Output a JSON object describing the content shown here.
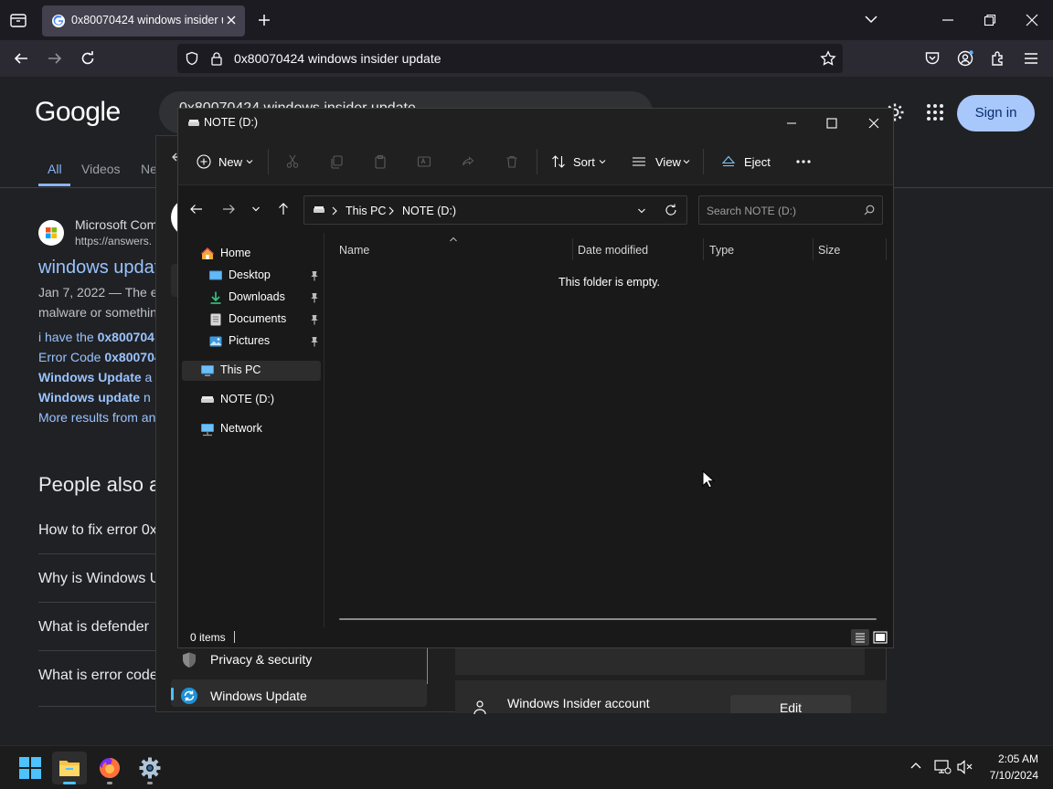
{
  "browser": {
    "tab_title": "0x80070424 windows insider update",
    "url": "0x80070424 windows insider update"
  },
  "google": {
    "logo": "Google",
    "search_partial": "0x80070424 windows insider update",
    "sign_in": "Sign in",
    "tabs": [
      "All",
      "Videos",
      "Ne"
    ],
    "result_source": "Microsoft Com",
    "result_url": "https://answers.",
    "result_title": "windows updat",
    "result_snippet_1": "Jan 7, 2022 — The e",
    "result_snippet_2": "malware or somethin",
    "sub_1_prefix": "i have the ",
    "sub_1_bold": "0x800704",
    "sub_2_prefix": "Error Code ",
    "sub_2_bold": "0x800704",
    "sub_3_bold": "Windows Update",
    "sub_3_suffix": " a",
    "sub_4_bold": "Windows update",
    "sub_4_suffix": " n",
    "more_results": "More results from an",
    "paa_heading": "People also a",
    "paa": [
      "How to fix error 0x",
      "Why is Windows U",
      "What is defender",
      "What is error code"
    ]
  },
  "settings_window": {
    "privacy": "Privacy & security",
    "windows_update": "Windows Update",
    "insider_account": "Windows Insider account",
    "edit": "Edit"
  },
  "explorer": {
    "title": "NOTE (D:)",
    "toolbar": {
      "new": "New",
      "sort": "Sort",
      "view": "View",
      "eject": "Eject"
    },
    "breadcrumb": [
      "This PC",
      "NOTE (D:)"
    ],
    "search_placeholder": "Search NOTE (D:)",
    "nav": {
      "home": "Home",
      "desktop": "Desktop",
      "downloads": "Downloads",
      "documents": "Documents",
      "pictures": "Pictures",
      "this_pc": "This PC",
      "note_drive": "NOTE (D:)",
      "network": "Network"
    },
    "columns": [
      "Name",
      "Date modified",
      "Type",
      "Size"
    ],
    "empty_message": "This folder is empty.",
    "status_items": "0 items"
  },
  "taskbar": {
    "time": "2:05 AM",
    "date": "7/10/2024"
  },
  "colors": {
    "accent_blue": "#a8c7fa",
    "link_blue": "#99c3ff",
    "explorer_bg": "#191919",
    "selected_nav": "#2d2d2d"
  }
}
